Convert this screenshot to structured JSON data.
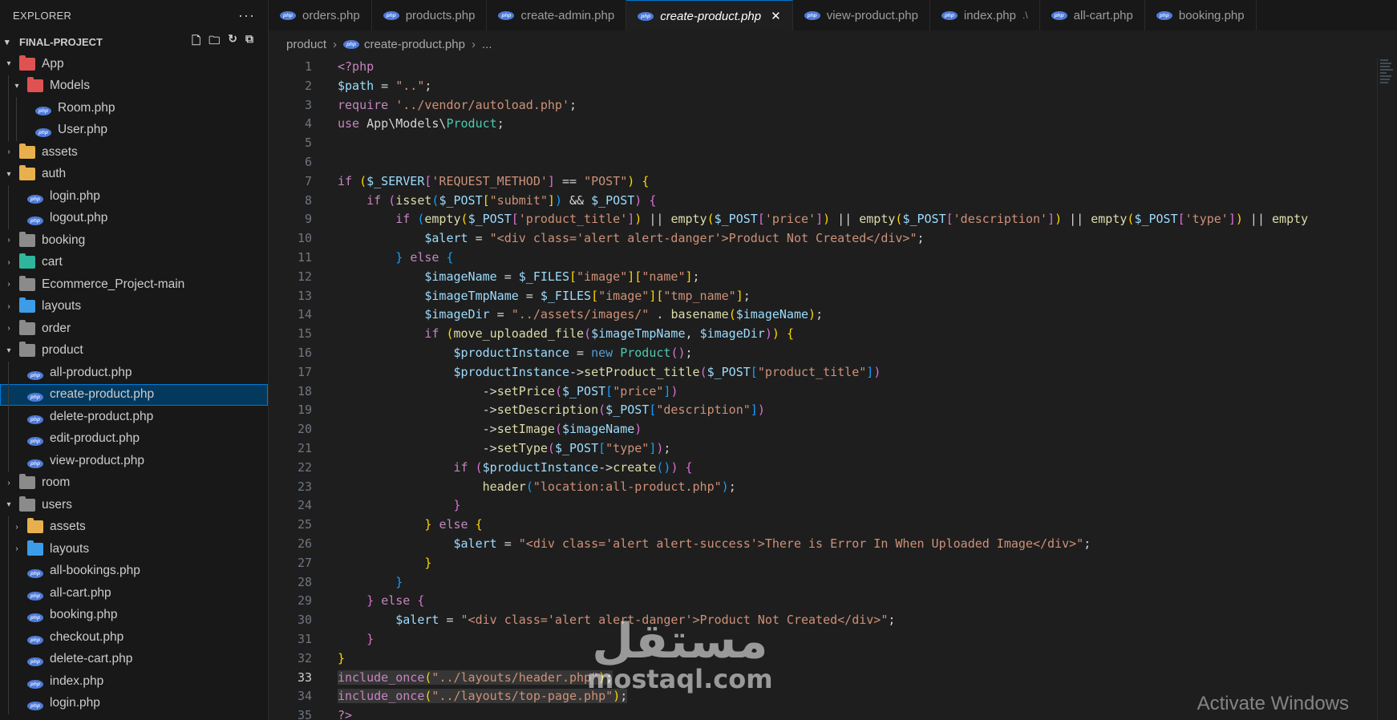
{
  "explorer": {
    "title": "EXPLORER",
    "more": "···",
    "project": "FINAL-PROJECT"
  },
  "tree": [
    {
      "label": "App",
      "type": "folder",
      "depth": 0,
      "open": true,
      "color": "#e05252"
    },
    {
      "label": "Models",
      "type": "folder",
      "depth": 1,
      "open": true,
      "color": "#e05252"
    },
    {
      "label": "Room.php",
      "type": "php",
      "depth": 2
    },
    {
      "label": "User.php",
      "type": "php",
      "depth": 2
    },
    {
      "label": "assets",
      "type": "folder",
      "depth": 0,
      "open": false,
      "color": "#e8b04c"
    },
    {
      "label": "auth",
      "type": "folder",
      "depth": 0,
      "open": true,
      "color": "#e8b04c"
    },
    {
      "label": "login.php",
      "type": "php",
      "depth": 1
    },
    {
      "label": "logout.php",
      "type": "php",
      "depth": 1
    },
    {
      "label": "booking",
      "type": "folder",
      "depth": 0,
      "open": false,
      "color": "#8b8b8b"
    },
    {
      "label": "cart",
      "type": "folder",
      "depth": 0,
      "open": false,
      "color": "#2fb59b"
    },
    {
      "label": "Ecommerce_Project-main",
      "type": "folder",
      "depth": 0,
      "open": false,
      "color": "#8b8b8b"
    },
    {
      "label": "layouts",
      "type": "folder",
      "depth": 0,
      "open": false,
      "color": "#3d9ce8"
    },
    {
      "label": "order",
      "type": "folder",
      "depth": 0,
      "open": false,
      "color": "#8b8b8b"
    },
    {
      "label": "product",
      "type": "folder",
      "depth": 0,
      "open": true,
      "color": "#8b8b8b"
    },
    {
      "label": "all-product.php",
      "type": "php",
      "depth": 1
    },
    {
      "label": "create-product.php",
      "type": "php",
      "depth": 1,
      "selected": true
    },
    {
      "label": "delete-product.php",
      "type": "php",
      "depth": 1
    },
    {
      "label": "edit-product.php",
      "type": "php",
      "depth": 1
    },
    {
      "label": "view-product.php",
      "type": "php",
      "depth": 1
    },
    {
      "label": "room",
      "type": "folder",
      "depth": 0,
      "open": false,
      "color": "#8b8b8b"
    },
    {
      "label": "users",
      "type": "folder",
      "depth": 0,
      "open": true,
      "color": "#8b8b8b"
    },
    {
      "label": "assets",
      "type": "folder",
      "depth": 1,
      "open": false,
      "color": "#e8b04c"
    },
    {
      "label": "layouts",
      "type": "folder",
      "depth": 1,
      "open": false,
      "color": "#3d9ce8"
    },
    {
      "label": "all-bookings.php",
      "type": "php",
      "depth": 1
    },
    {
      "label": "all-cart.php",
      "type": "php",
      "depth": 1
    },
    {
      "label": "booking.php",
      "type": "php",
      "depth": 1
    },
    {
      "label": "checkout.php",
      "type": "php",
      "depth": 1
    },
    {
      "label": "delete-cart.php",
      "type": "php",
      "depth": 1
    },
    {
      "label": "index.php",
      "type": "php",
      "depth": 1
    },
    {
      "label": "login.php",
      "type": "php",
      "depth": 1
    }
  ],
  "tabs": [
    {
      "label": "orders.php"
    },
    {
      "label": "products.php"
    },
    {
      "label": "create-admin.php"
    },
    {
      "label": "create-product.php",
      "active": true
    },
    {
      "label": "view-product.php"
    },
    {
      "label": "index.php",
      "path": ".\\"
    },
    {
      "label": "all-cart.php"
    },
    {
      "label": "booking.php"
    }
  ],
  "breadcrumb": {
    "folder": "product",
    "file": "create-product.php",
    "more": "..."
  },
  "code": [
    {
      "n": "1",
      "html": "<span class='k'>&lt;?php</span>"
    },
    {
      "n": "2",
      "html": "<span class='v'>$path</span> = <span class='s'>\"..\"</span>;"
    },
    {
      "n": "3",
      "html": "<span class='k'>require</span> <span class='s'>'../vendor/autoload.php'</span>;"
    },
    {
      "n": "4",
      "html": "<span class='k'>use</span> App\\Models\\<span class='c'>Product</span>;"
    },
    {
      "n": "5",
      "html": ""
    },
    {
      "n": "6",
      "html": ""
    },
    {
      "n": "7",
      "html": "<span class='k'>if</span> <span class='b1'>(</span><span class='v'>$_SERVER</span><span class='b2'>[</span><span class='s'>'REQUEST_METHOD'</span><span class='b2'>]</span> == <span class='s'>\"POST\"</span><span class='b1'>)</span> <span class='b1'>{</span>"
    },
    {
      "n": "8",
      "html": "    <span class='k'>if</span> <span class='b2'>(</span><span class='f'>isset</span><span class='b3'>(</span><span class='v'>$_POST</span><span class='b1'>[</span><span class='s'>\"submit\"</span><span class='b1'>]</span><span class='b3'>)</span> &amp;&amp; <span class='v'>$_POST</span><span class='b2'>)</span> <span class='b2'>{</span>"
    },
    {
      "n": "9",
      "html": "        <span class='k'>if</span> <span class='b3'>(</span><span class='f'>empty</span><span class='b1'>(</span><span class='v'>$_POST</span><span class='b2'>[</span><span class='s'>'product_title'</span><span class='b2'>]</span><span class='b1'>)</span> || <span class='f'>empty</span><span class='b1'>(</span><span class='v'>$_POST</span><span class='b2'>[</span><span class='s'>'price'</span><span class='b2'>]</span><span class='b1'>)</span> || <span class='f'>empty</span><span class='b1'>(</span><span class='v'>$_POST</span><span class='b2'>[</span><span class='s'>'description'</span><span class='b2'>]</span><span class='b1'>)</span> || <span class='f'>empty</span><span class='b1'>(</span><span class='v'>$_POST</span><span class='b2'>[</span><span class='s'>'type'</span><span class='b2'>]</span><span class='b1'>)</span> || <span class='f'>empty</span>"
    },
    {
      "n": "10",
      "html": "            <span class='v'>$alert</span> = <span class='s'>\"&lt;div class='alert alert-danger'&gt;Product Not Created&lt;/div&gt;\"</span>;"
    },
    {
      "n": "11",
      "html": "        <span class='b3'>}</span> <span class='k'>else</span> <span class='b3'>{</span>"
    },
    {
      "n": "12",
      "html": "            <span class='v'>$imageName</span> = <span class='v'>$_FILES</span><span class='b1'>[</span><span class='s'>\"image\"</span><span class='b1'>][</span><span class='s'>\"name\"</span><span class='b1'>]</span>;"
    },
    {
      "n": "13",
      "html": "            <span class='v'>$imageTmpName</span> = <span class='v'>$_FILES</span><span class='b1'>[</span><span class='s'>\"image\"</span><span class='b1'>][</span><span class='s'>\"tmp_name\"</span><span class='b1'>]</span>;"
    },
    {
      "n": "14",
      "html": "            <span class='v'>$imageDir</span> = <span class='s'>\"../assets/images/\"</span> . <span class='f'>basename</span><span class='b1'>(</span><span class='v'>$imageName</span><span class='b1'>)</span>;"
    },
    {
      "n": "15",
      "html": "            <span class='k'>if</span> <span class='b1'>(</span><span class='f'>move_uploaded_file</span><span class='b2'>(</span><span class='v'>$imageTmpName</span>, <span class='v'>$imageDir</span><span class='b2'>)</span><span class='b1'>)</span> <span class='b1'>{</span>"
    },
    {
      "n": "16",
      "html": "                <span class='v'>$productInstance</span> = <span class='kb'>new</span> <span class='c'>Product</span><span class='b2'>()</span>;"
    },
    {
      "n": "17",
      "html": "                <span class='v'>$productInstance</span>-&gt;<span class='f'>setProduct_title</span><span class='b2'>(</span><span class='v'>$_POST</span><span class='b3'>[</span><span class='s'>\"product_title\"</span><span class='b3'>]</span><span class='b2'>)</span>"
    },
    {
      "n": "18",
      "html": "                    -&gt;<span class='f'>setPrice</span><span class='b2'>(</span><span class='v'>$_POST</span><span class='b3'>[</span><span class='s'>\"price\"</span><span class='b3'>]</span><span class='b2'>)</span>"
    },
    {
      "n": "19",
      "html": "                    -&gt;<span class='f'>setDescription</span><span class='b2'>(</span><span class='v'>$_POST</span><span class='b3'>[</span><span class='s'>\"description\"</span><span class='b3'>]</span><span class='b2'>)</span>"
    },
    {
      "n": "20",
      "html": "                    -&gt;<span class='f'>setImage</span><span class='b2'>(</span><span class='v'>$imageName</span><span class='b2'>)</span>"
    },
    {
      "n": "21",
      "html": "                    -&gt;<span class='f'>setType</span><span class='b2'>(</span><span class='v'>$_POST</span><span class='b3'>[</span><span class='s'>\"type\"</span><span class='b3'>]</span><span class='b2'>)</span>;"
    },
    {
      "n": "22",
      "html": "                <span class='k'>if</span> <span class='b2'>(</span><span class='v'>$productInstance</span>-&gt;<span class='f'>create</span><span class='b3'>()</span><span class='b2'>)</span> <span class='b2'>{</span>"
    },
    {
      "n": "23",
      "html": "                    <span class='f'>header</span><span class='b3'>(</span><span class='s'>\"location:all-product.php\"</span><span class='b3'>)</span>;"
    },
    {
      "n": "24",
      "html": "                <span class='b2'>}</span>"
    },
    {
      "n": "25",
      "html": "            <span class='b1'>}</span> <span class='k'>else</span> <span class='b1'>{</span>"
    },
    {
      "n": "26",
      "html": "                <span class='v'>$alert</span> = <span class='s'>\"&lt;div class='alert alert-success'&gt;There is Error In When Uploaded Image&lt;/div&gt;\"</span>;"
    },
    {
      "n": "27",
      "html": "            <span class='b1'>}</span>"
    },
    {
      "n": "28",
      "html": "        <span class='b3'>}</span>"
    },
    {
      "n": "29",
      "html": "    <span class='b2'>}</span> <span class='k'>else</span> <span class='b2'>{</span>"
    },
    {
      "n": "30",
      "html": "        <span class='v'>$alert</span> = <span class='s'>\"&lt;div class='alert alert-danger'&gt;Product Not Created&lt;/div&gt;\"</span>;"
    },
    {
      "n": "31",
      "html": "    <span class='b2'>}</span>"
    },
    {
      "n": "32",
      "html": "<span class='b1'>}</span>"
    },
    {
      "n": "33",
      "html": "<span class='hl'><span class='k'>include_once</span><span class='b1'>(</span><span class='s'>\"../layouts/header.php\"</span><span class='b1'>)</span>;</span>",
      "active": true
    },
    {
      "n": "34",
      "html": "<span class='hl'><span class='k'>include_once</span><span class='b1'>(</span><span class='s'>\"../layouts/top-page.php\"</span><span class='b1'>)</span>;</span>"
    },
    {
      "n": "35",
      "html": "<span class='k'>?&gt;</span>"
    }
  ],
  "watermark": {
    "arabic": "مستقل",
    "latin": "mostaql.com"
  },
  "os_notice": "Activate Windows"
}
